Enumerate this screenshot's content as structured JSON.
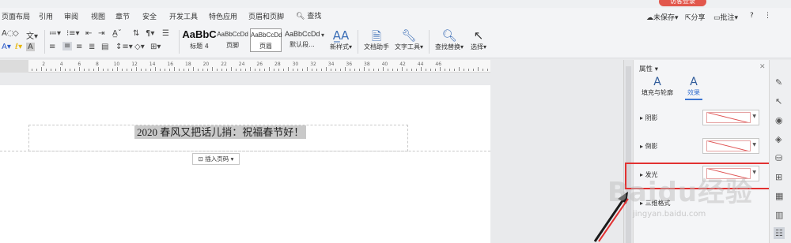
{
  "menu": {
    "items": [
      "页面布局",
      "引用",
      "审阅",
      "视图",
      "章节",
      "安全",
      "开发工具",
      "特色应用",
      "页眉和页脚"
    ],
    "search": "查找",
    "user": "访客登录",
    "right": {
      "unsaved": "未保存",
      "share": "分享",
      "annotate": "批注",
      "help": "?",
      "more": "⋮"
    }
  },
  "ribbon": {
    "styles": [
      {
        "sample": "AaBbC",
        "name": "标题 4"
      },
      {
        "sample": "AaBbCcDd",
        "name": "页脚"
      },
      {
        "sample": "AaBbCcDd",
        "name": "页眉"
      },
      {
        "sample": "AaBbCcDd",
        "name": "默认段..."
      }
    ],
    "new_style": "新样式",
    "doc_helper": "文档助手",
    "text_tools": "文字工具",
    "find_replace": "查找替换",
    "select": "选择"
  },
  "ruler": {
    "labels": [
      "4",
      "2",
      "2",
      "4",
      "6",
      "8",
      "10",
      "12",
      "14",
      "16",
      "18",
      "20",
      "22",
      "24",
      "26",
      "28",
      "30",
      "32",
      "34",
      "36",
      "38",
      "40",
      "42",
      "44",
      "46"
    ]
  },
  "document": {
    "header_text": "2020 春风又把话儿捎：祝福春节好！",
    "insert_page_number": "插入页码"
  },
  "panel": {
    "title": "属性",
    "tabs": [
      "填充与轮廓",
      "效果"
    ],
    "rows": [
      "阴影",
      "倒影",
      "发光",
      "三维格式"
    ]
  },
  "watermark": {
    "logo": "Baidu经验",
    "url": "jingyan.baidu.com"
  }
}
